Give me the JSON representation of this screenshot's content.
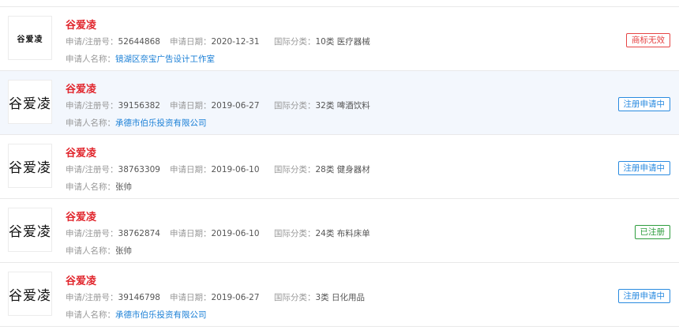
{
  "labels": {
    "reg_no": "申请/注册号：",
    "apply_date": "申请日期：",
    "intl_class": "国际分类：",
    "applicant": "申请人名称："
  },
  "colors": {
    "name": "#e1262d",
    "link": "#1a7fd6",
    "status_invalid": "#e64545",
    "status_pending": "#2a8be0",
    "status_registered": "#2e9d3e"
  },
  "items": [
    {
      "name": "谷爱凌",
      "thumb_text": "谷爱凌",
      "reg_no": "52644868",
      "apply_date": "2020-12-31",
      "intl_class": "10类 医疗器械",
      "applicant": "镜湖区奈宝广告设计工作室",
      "status": "商标无效"
    },
    {
      "name": "谷爱凌",
      "thumb_text": "谷爱凌",
      "reg_no": "39156382",
      "apply_date": "2019-06-27",
      "intl_class": "32类 啤酒饮料",
      "applicant": "承德市伯乐投资有限公司",
      "status": "注册申请中"
    },
    {
      "name": "谷爱凌",
      "thumb_text": "谷爱凌",
      "reg_no": "38763309",
      "apply_date": "2019-06-10",
      "intl_class": "28类 健身器材",
      "applicant": "张帅",
      "status": "注册申请中"
    },
    {
      "name": "谷爱凌",
      "thumb_text": "谷爱凌",
      "reg_no": "38762874",
      "apply_date": "2019-06-10",
      "intl_class": "24类 布料床单",
      "applicant": "张帅",
      "status": "已注册"
    },
    {
      "name": "谷爱凌",
      "thumb_text": "谷爱凌",
      "reg_no": "39146798",
      "apply_date": "2019-06-27",
      "intl_class": "3类 日化用品",
      "applicant": "承德市伯乐投资有限公司",
      "status": "注册申请中"
    }
  ]
}
